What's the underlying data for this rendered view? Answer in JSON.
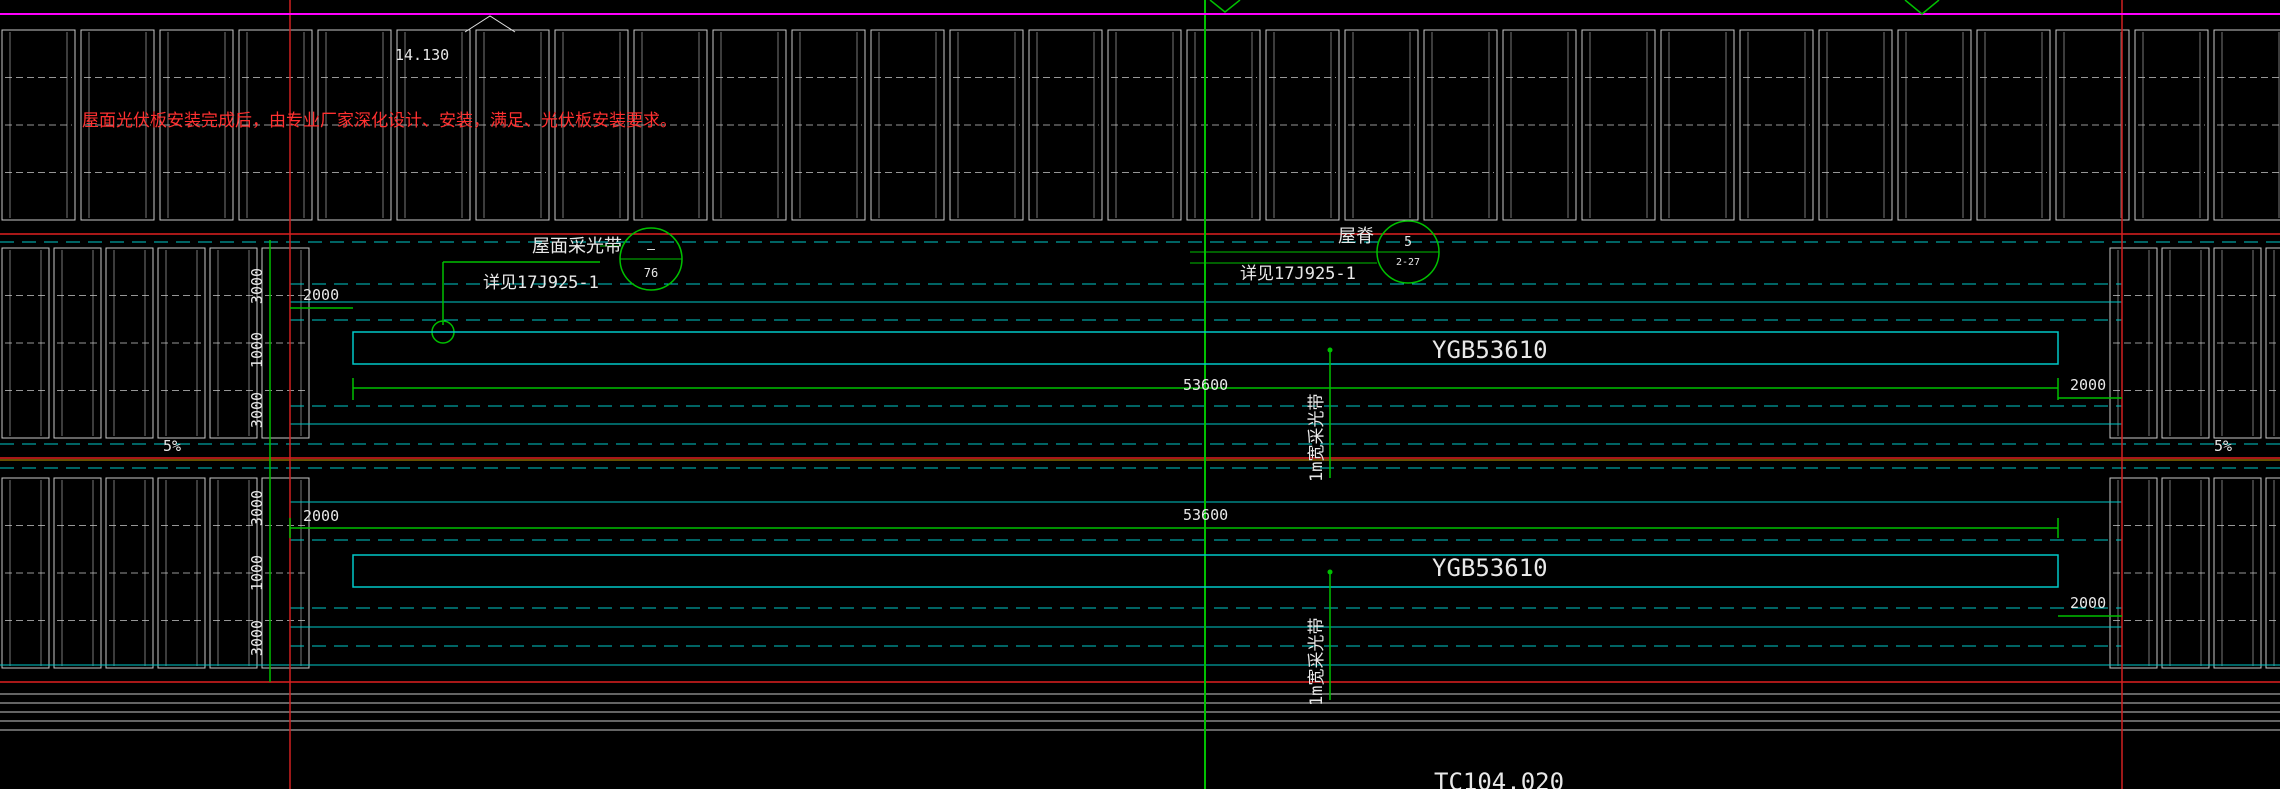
{
  "drawing": {
    "elevation_label": "14.130",
    "note_text": "屋面光伏板安装完成后，由专业厂家深化设计、安装，满足、光伏板安装要求。",
    "top": {
      "skylight_label": "屋面采光带",
      "detail_ref": "详见17J925-1",
      "callout_top": "—",
      "callout_bottom": "76"
    },
    "ridge": {
      "label": "屋脊",
      "detail_ref": "详见17J925-1",
      "callout_top": "5",
      "callout_bottom": "2-27"
    },
    "band1": {
      "dim_left_top": "3000",
      "dim_left_mid": "1000",
      "dim_left_bottom": "3000",
      "offset_left": "2000",
      "panel_label": "YGB53610",
      "length_dim": "53600",
      "offset_right": "2000",
      "skylight_width_label": "1m宽采光带",
      "slope_left": "5%",
      "slope_right": "5%"
    },
    "band2": {
      "dim_left_top": "3000",
      "dim_left_mid": "1000",
      "dim_left_bottom": "3000",
      "offset_left": "2000",
      "panel_label": "YGB53610",
      "length_dim": "53600",
      "offset_right": "2000",
      "skylight_width_label": "1m宽采光带"
    },
    "bottom_label": "TC104.020",
    "colors": {
      "background": "#000000",
      "panel": "#c8c8c8",
      "cyan": "#00c8c8",
      "green": "#00e000",
      "red": "#e02020",
      "magenta": "#ff00ff",
      "text": "#e8e8e8",
      "note": "#ff3030"
    }
  }
}
